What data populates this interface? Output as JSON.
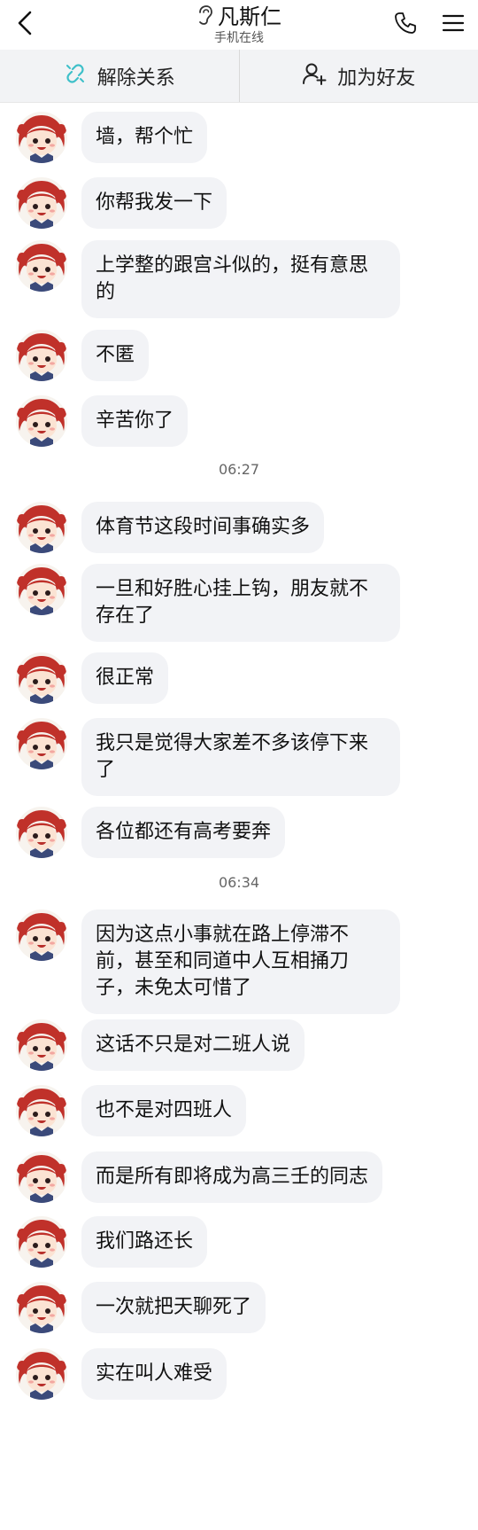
{
  "header": {
    "contact_name": "凡斯仁",
    "status": "手机在线",
    "icons": {
      "back": "back-arrow-icon",
      "ear": "ear-icon",
      "call": "phone-icon",
      "menu": "menu-icon"
    }
  },
  "actions": {
    "unbind_label": "解除关系",
    "add_friend_label": "加为好友"
  },
  "colors": {
    "bubble_bg": "#f2f3f6",
    "actionbar_bg": "#f2f3f5",
    "link_icon": "#3ec0c9"
  },
  "messages": [
    {
      "type": "msg",
      "text": "墙，帮个忙"
    },
    {
      "type": "msg",
      "text": "你帮我发一下"
    },
    {
      "type": "msg",
      "text": "上学整的跟宫斗似的，挺有意思的"
    },
    {
      "type": "msg",
      "text": "不匿"
    },
    {
      "type": "msg",
      "text": "辛苦你了"
    },
    {
      "type": "time",
      "text": "06:27"
    },
    {
      "type": "msg",
      "text": "体育节这段时间事确实多"
    },
    {
      "type": "msg",
      "text": "一旦和好胜心挂上钩，朋友就不存在了"
    },
    {
      "type": "msg",
      "text": "很正常"
    },
    {
      "type": "msg",
      "text": "我只是觉得大家差不多该停下来了"
    },
    {
      "type": "msg",
      "text": "各位都还有高考要奔"
    },
    {
      "type": "time",
      "text": "06:34"
    },
    {
      "type": "msg",
      "text": "因为这点小事就在路上停滞不前，甚至和同道中人互相捅刀子，未免太可惜了"
    },
    {
      "type": "msg",
      "text": "这话不只是对二班人说"
    },
    {
      "type": "msg",
      "text": "也不是对四班人"
    },
    {
      "type": "msg",
      "text": "而是所有即将成为高三壬的同志"
    },
    {
      "type": "msg",
      "text": "我们路还长"
    },
    {
      "type": "msg",
      "text": "一次就把天聊死了"
    },
    {
      "type": "msg",
      "text": "实在叫人难受"
    }
  ]
}
